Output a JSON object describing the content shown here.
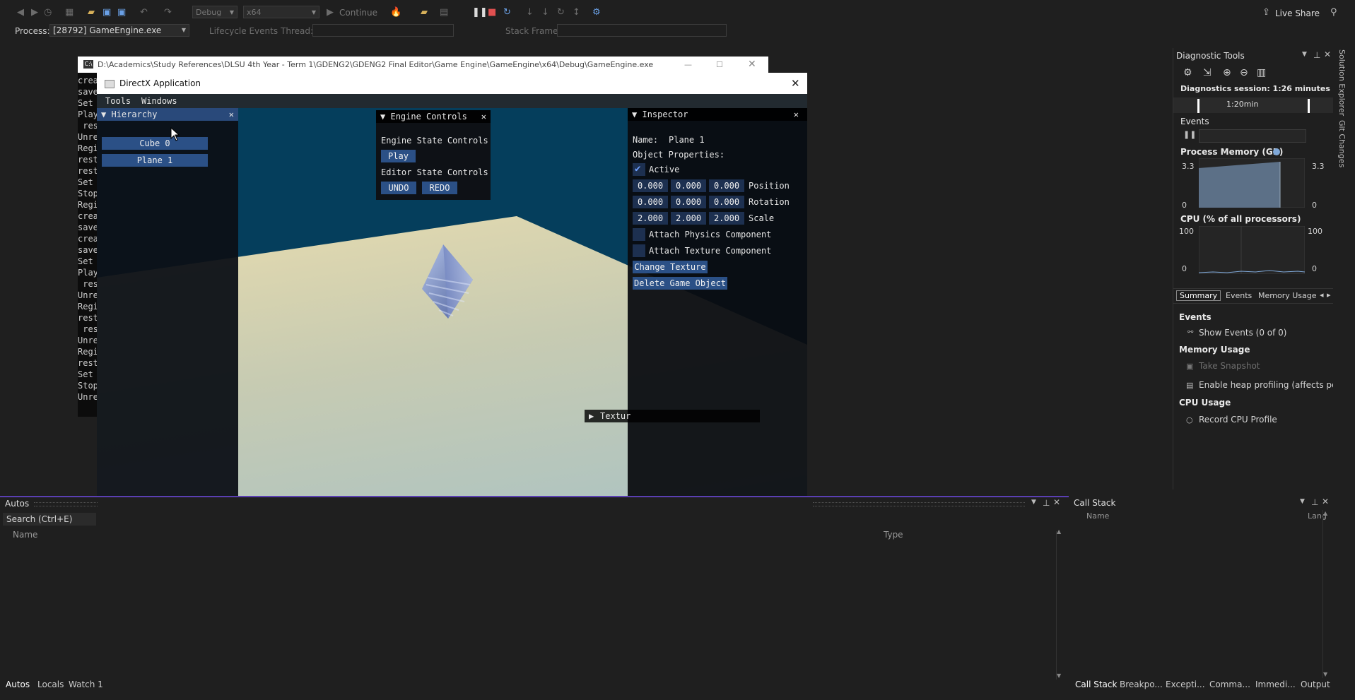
{
  "toolbar": {
    "config": "Debug",
    "platform": "x64",
    "continue_label": "Continue",
    "live_share": "Live Share",
    "process_label": "Process:",
    "process_value": "[28792] GameEngine.exe",
    "lifecycle_label": "Lifecycle Events",
    "thread_label": "Thread:",
    "stack_frame_label": "Stack Frame:"
  },
  "console": {
    "title": "D:\\Academics\\Study References\\DLSU 4th Year - Term 1\\GDENG2\\GDENG2 Final Editor\\Game Engine\\GameEngine\\x64\\Debug\\GameEngine.exe",
    "lines": [
      "crea",
      "save",
      "Set",
      "Play",
      " res",
      "Unre",
      "Regi",
      "rest",
      "rest",
      "Set",
      "Stop",
      "Regi",
      "crea",
      "save",
      "crea",
      "save",
      "Set",
      "Play",
      " res",
      "Unre",
      "Regi",
      "rest",
      " res",
      "Unre",
      "Regi",
      "rest",
      "Set",
      "Stop",
      "Unre"
    ]
  },
  "dx": {
    "title": "DirectX Application",
    "menu": [
      "Tools",
      "Windows"
    ]
  },
  "hierarchy": {
    "title": "Hierarchy",
    "items": [
      "Cube 0",
      "Plane 1"
    ]
  },
  "engine_controls": {
    "title": "Engine Controls",
    "state_label": "Engine State Controls",
    "play": "Play",
    "editor_label": "Editor State Controls",
    "undo": "UNDO",
    "redo": "REDO"
  },
  "inspector": {
    "title": "Inspector",
    "name_label": "Name:",
    "name_value": "Plane 1",
    "props_label": "Object Properties:",
    "active_label": "Active",
    "position": [
      "0.000",
      "0.000",
      "0.000"
    ],
    "position_label": "Position",
    "rotation": [
      "0.000",
      "0.000",
      "0.000"
    ],
    "rotation_label": "Rotation",
    "scale": [
      "2.000",
      "2.000",
      "2.000"
    ],
    "scale_label": "Scale",
    "physics_label": "Attach Physics Component",
    "texture_label": "Attach Texture Component",
    "change_texture": "Change Texture",
    "delete_object": "Delete Game Object",
    "texture_collapsed": "Textur"
  },
  "diagnostics": {
    "title": "Diagnostic Tools",
    "session": "Diagnostics session: 1:26 minutes",
    "timeline_tick": "1:20min",
    "events_section": "Events",
    "memory_section": "Process Memory (GB)",
    "mem_max": "3.3",
    "mem_min": "0",
    "cpu_section": "CPU (% of all processors)",
    "cpu_max": "100",
    "cpu_min": "0",
    "tabs": [
      "Summary",
      "Events",
      "Memory Usage"
    ],
    "events_head": "Events",
    "show_events": "Show Events (0 of 0)",
    "memory_head": "Memory Usage",
    "take_snapshot": "Take Snapshot",
    "heap_profiling": "Enable heap profiling (affects perfor",
    "cpu_head": "CPU Usage",
    "record_cpu": "Record CPU Profile"
  },
  "side_tabs": [
    "Solution Explorer",
    "Git Changes"
  ],
  "autos": {
    "title": "Autos",
    "search": "Search (Ctrl+E)",
    "col_name": "Name",
    "col_type": "Type",
    "tabs": [
      "Autos",
      "Locals",
      "Watch 1"
    ]
  },
  "callstack": {
    "title": "Call Stack",
    "col_name": "Name",
    "col_lang": "Lang",
    "tabs": [
      "Call Stack",
      "Breakpo...",
      "Excepti...",
      "Comma...",
      "Immedi...",
      "Output"
    ]
  }
}
